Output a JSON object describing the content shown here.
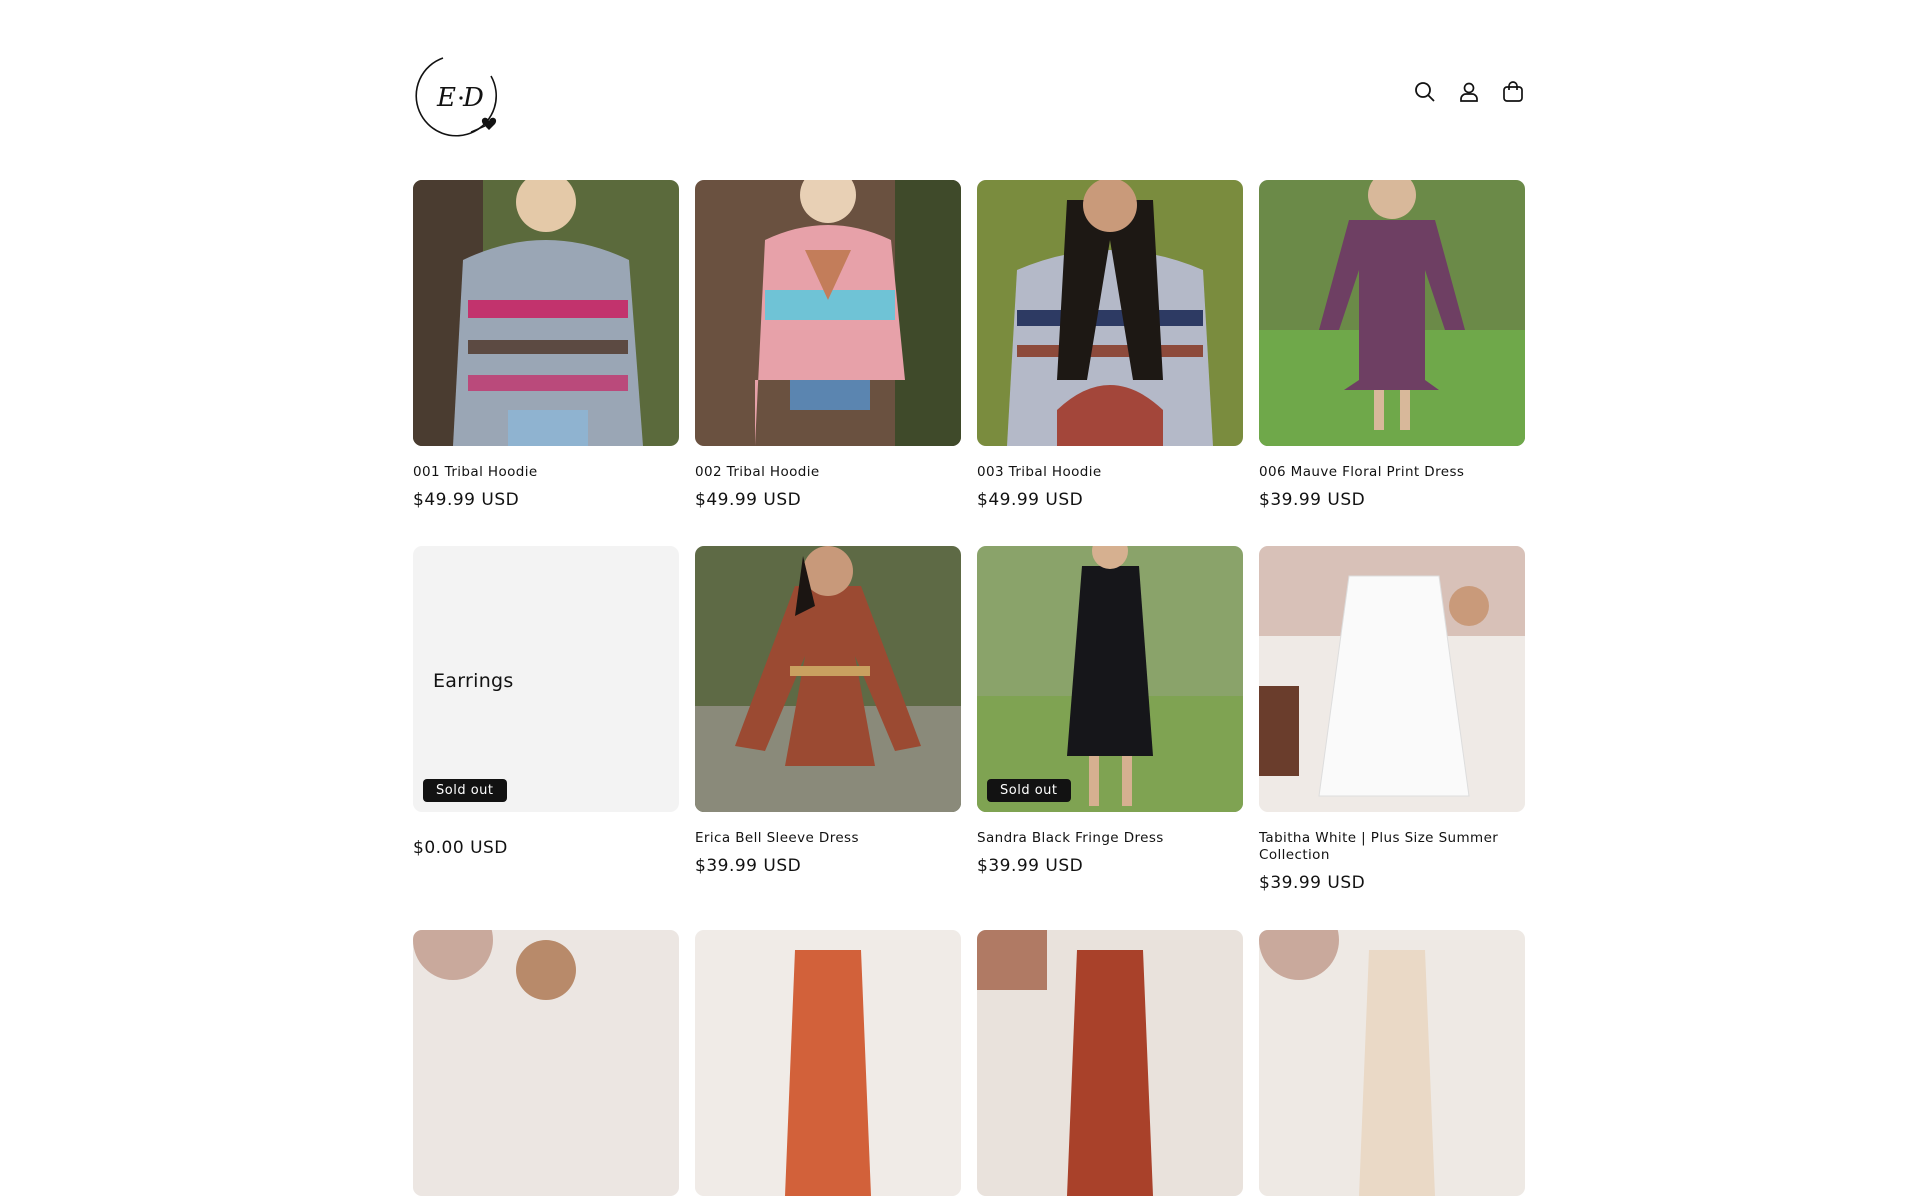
{
  "header": {
    "logo_alt": "E·D",
    "icons": [
      "search-icon",
      "account-icon",
      "cart-icon"
    ]
  },
  "products": [
    {
      "title": "001 Tribal Hoodie",
      "price": "$49.99 USD"
    },
    {
      "title": "002 Tribal Hoodie",
      "price": "$49.99 USD"
    },
    {
      "title": "003 Tribal Hoodie",
      "price": "$49.99 USD"
    },
    {
      "title": "006 Mauve Floral Print Dress",
      "price": "$39.99 USD"
    },
    {
      "title": "Earrings",
      "price": "$0.00 USD",
      "badge": "Sold out"
    },
    {
      "title": "Erica Bell Sleeve Dress",
      "price": "$39.99 USD"
    },
    {
      "title": "Sandra Black Fringe Dress",
      "price": "$39.99 USD",
      "badge": "Sold out"
    },
    {
      "title": "Tabitha White | Plus Size Summer Collection",
      "price": "$39.99 USD"
    }
  ],
  "colors": {
    "text": "#121212",
    "badge_bg": "#121212",
    "badge_text": "#ffffff",
    "placeholder_bg": "#f3f3f3"
  }
}
